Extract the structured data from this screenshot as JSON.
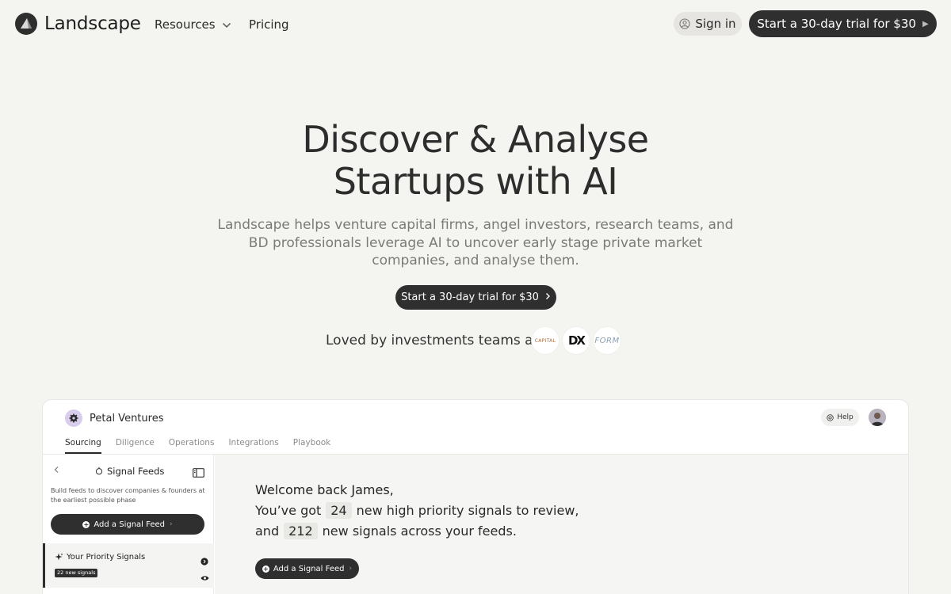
{
  "nav": {
    "brand": "Landscape",
    "resources": "Resources",
    "pricing": "Pricing",
    "sign_in": "Sign in",
    "cta": "Start a 30-day trial for $30"
  },
  "hero": {
    "title_line1": "Discover & Analyse",
    "title_line2": "Startups with AI",
    "subtitle": "Landscape helps venture capital firms, angel investors, research teams, and BD professionals leverage AI to uncover early stage private market companies, and analyse them.",
    "cta": "Start a 30-day trial for $30",
    "loved_by": "Loved by investments teams at",
    "customer_logos": [
      "CAPITAL",
      "DX",
      "FORM"
    ]
  },
  "app": {
    "org_name": "Petal Ventures",
    "help": "Help",
    "tabs": [
      "Sourcing",
      "Diligence",
      "Operations",
      "Integrations",
      "Playbook"
    ],
    "active_tab": "Sourcing",
    "sidebar": {
      "title": "Signal Feeds",
      "description": "Build feeds to discover companies & founders at the earliest possible phase",
      "add_button": "Add a Signal Feed",
      "priority_title": "Your Priority Signals",
      "priority_badge": "22 new signals"
    },
    "main": {
      "welcome": "Welcome back James,",
      "line2_prefix": "You’ve got",
      "high_priority_count": "24",
      "line2_suffix": "new high priority signals to review,",
      "line3_prefix": "and",
      "signal_count": "212",
      "line3_suffix": "new signals across your feeds.",
      "add_button": "Add a Signal Feed"
    }
  },
  "colors": {
    "background": "#f4f4f0",
    "primary_button": "#2f2f2f",
    "muted_text": "#7a7a78"
  }
}
